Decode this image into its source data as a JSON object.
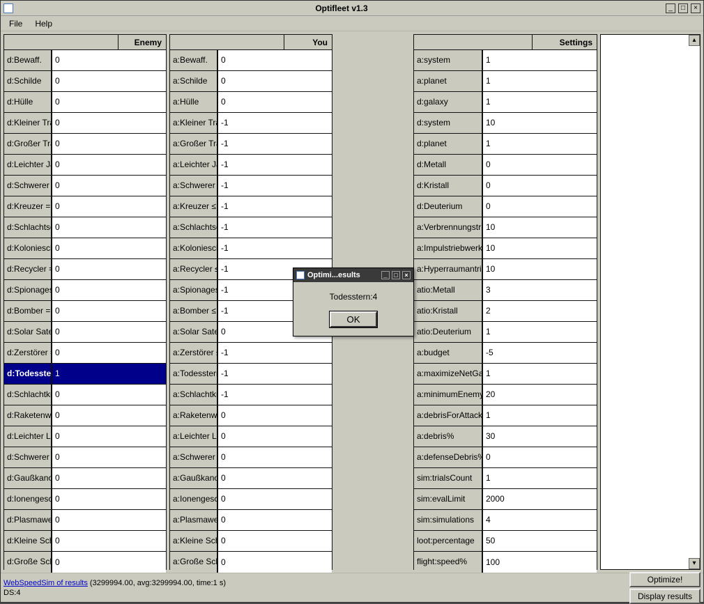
{
  "window": {
    "title": "Optifleet v1.3"
  },
  "menu": {
    "file": "File",
    "help": "Help"
  },
  "headers": {
    "enemy": "Enemy",
    "you": "You",
    "settings": "Settings"
  },
  "enemy_rows": [
    {
      "label": "d:Bewaff.",
      "value": "0",
      "selected": false
    },
    {
      "label": "d:Schilde",
      "value": "0",
      "selected": false
    },
    {
      "label": "d:Hülle",
      "value": "0",
      "selected": false
    },
    {
      "label": "d:Kleiner Transporter =",
      "value": "0",
      "selected": false
    },
    {
      "label": "d:Großer Transporter =",
      "value": "0",
      "selected": false
    },
    {
      "label": "d:Leichter Jäger =",
      "value": "0",
      "selected": false
    },
    {
      "label": "d:Schwerer Jäger =",
      "value": "0",
      "selected": false
    },
    {
      "label": "d:Kreuzer =",
      "value": "0",
      "selected": false
    },
    {
      "label": "d:Schlachtschiff =",
      "value": "0",
      "selected": false
    },
    {
      "label": "d:Kolonieschiff =",
      "value": "0",
      "selected": false
    },
    {
      "label": "d:Recycler =",
      "value": "0",
      "selected": false
    },
    {
      "label": "d:Spionagesonde =",
      "value": "0",
      "selected": false
    },
    {
      "label": "d:Bomber =",
      "value": "0",
      "selected": false
    },
    {
      "label": "d:Solar Satellit =",
      "value": "0",
      "selected": false
    },
    {
      "label": "d:Zerstörer =",
      "value": "0",
      "selected": false
    },
    {
      "label": "d:Todesstern =",
      "value": "1",
      "selected": true
    },
    {
      "label": "d:Schlachtkreuzer =",
      "value": "0",
      "selected": false
    },
    {
      "label": "d:Raketenwerfer =",
      "value": "0",
      "selected": false
    },
    {
      "label": "d:Leichter Laser =",
      "value": "0",
      "selected": false
    },
    {
      "label": "d:Schwerer Laser =",
      "value": "0",
      "selected": false
    },
    {
      "label": "d:Gaußkanone =",
      "value": "0",
      "selected": false
    },
    {
      "label": "d:Ionengeschütz =",
      "value": "0",
      "selected": false
    },
    {
      "label": "d:Plasmawerfer =",
      "value": "0",
      "selected": false
    },
    {
      "label": "d:Kleine Schildkuppel =",
      "value": "0",
      "selected": false
    },
    {
      "label": "d:Große Schildkuppel =",
      "value": "0",
      "selected": false
    }
  ],
  "you_rows": [
    {
      "label": "a:Bewaff.",
      "value": "0"
    },
    {
      "label": "a:Schilde",
      "value": "0"
    },
    {
      "label": "a:Hülle",
      "value": "0"
    },
    {
      "label": "a:Kleiner Transporter ≤",
      "value": "-1"
    },
    {
      "label": "a:Großer Transporter ≤",
      "value": "-1"
    },
    {
      "label": "a:Leichter Jäger ≤",
      "value": "-1"
    },
    {
      "label": "a:Schwerer Jäger ≤",
      "value": "-1"
    },
    {
      "label": "a:Kreuzer ≤",
      "value": "-1"
    },
    {
      "label": "a:Schlachtschiff ≤",
      "value": "-1"
    },
    {
      "label": "a:Kolonieschiff ≤",
      "value": "-1"
    },
    {
      "label": "a:Recycler ≤",
      "value": "-1"
    },
    {
      "label": "a:Spionagesonde ≤",
      "value": "-1"
    },
    {
      "label": "a:Bomber ≤",
      "value": "-1"
    },
    {
      "label": "a:Solar Satellit ≤",
      "value": "0"
    },
    {
      "label": "a:Zerstörer ≤",
      "value": "-1"
    },
    {
      "label": "a:Todesstern ≤",
      "value": "-1"
    },
    {
      "label": "a:Schlachtkreuzer ≤",
      "value": "-1"
    },
    {
      "label": "a:Raketenwerfer ≤",
      "value": "0"
    },
    {
      "label": "a:Leichter Laser ≤",
      "value": "0"
    },
    {
      "label": "a:Schwerer Laser ≤",
      "value": "0"
    },
    {
      "label": "a:Gaußkanone ≤",
      "value": "0"
    },
    {
      "label": "a:Ionengeschütz ≤",
      "value": "0"
    },
    {
      "label": "a:Plasmawerfer ≤",
      "value": "0"
    },
    {
      "label": "a:Kleine Schildkuppel ≤",
      "value": "0"
    },
    {
      "label": "a:Große Schildkuppel ≤",
      "value": "0"
    }
  ],
  "settings_rows": [
    {
      "label": "a:system",
      "value": "1"
    },
    {
      "label": "a:planet",
      "value": "1"
    },
    {
      "label": "d:galaxy",
      "value": "1"
    },
    {
      "label": "d:system",
      "value": "10"
    },
    {
      "label": "d:planet",
      "value": "1"
    },
    {
      "label": "d:Metall",
      "value": "0"
    },
    {
      "label": "d:Kristall",
      "value": "0"
    },
    {
      "label": "d:Deuterium",
      "value": "0"
    },
    {
      "label": "a:Verbrennungstriebwerk",
      "value": "10"
    },
    {
      "label": "a:Impulstriebwerk",
      "value": "10"
    },
    {
      "label": "a:Hyperraumantrieb",
      "value": "10"
    },
    {
      "label": "atio:Metall",
      "value": "3"
    },
    {
      "label": "atio:Kristall",
      "value": "2"
    },
    {
      "label": "atio:Deuterium",
      "value": "1"
    },
    {
      "label": "a:budget",
      "value": "-5"
    },
    {
      "label": "a:maximizeNetGain",
      "value": "1"
    },
    {
      "label": "a:minimumEnemyLoss%",
      "value": "20"
    },
    {
      "label": "a:debrisForAttacker",
      "value": "1"
    },
    {
      "label": "a:debris%",
      "value": "30"
    },
    {
      "label": "a:defenseDebris%",
      "value": "0"
    },
    {
      "label": "sim:trialsCount",
      "value": "1"
    },
    {
      "label": "sim:evalLimit",
      "value": "2000"
    },
    {
      "label": "sim:simulations",
      "value": "4"
    },
    {
      "label": "loot:percentage",
      "value": "50"
    },
    {
      "label": "flight:speed%",
      "value": "100"
    }
  ],
  "status": {
    "link_text": "WebSpeedSim of results",
    "stats": " (3299994.00, avg:3299994.00, time:1 s)",
    "ds": "DS:4"
  },
  "buttons": {
    "optimize": "Optimize!",
    "display": "Display results"
  },
  "dialog": {
    "title": "Optimi...esults",
    "text": "Todesstern:4",
    "ok": "OK"
  }
}
